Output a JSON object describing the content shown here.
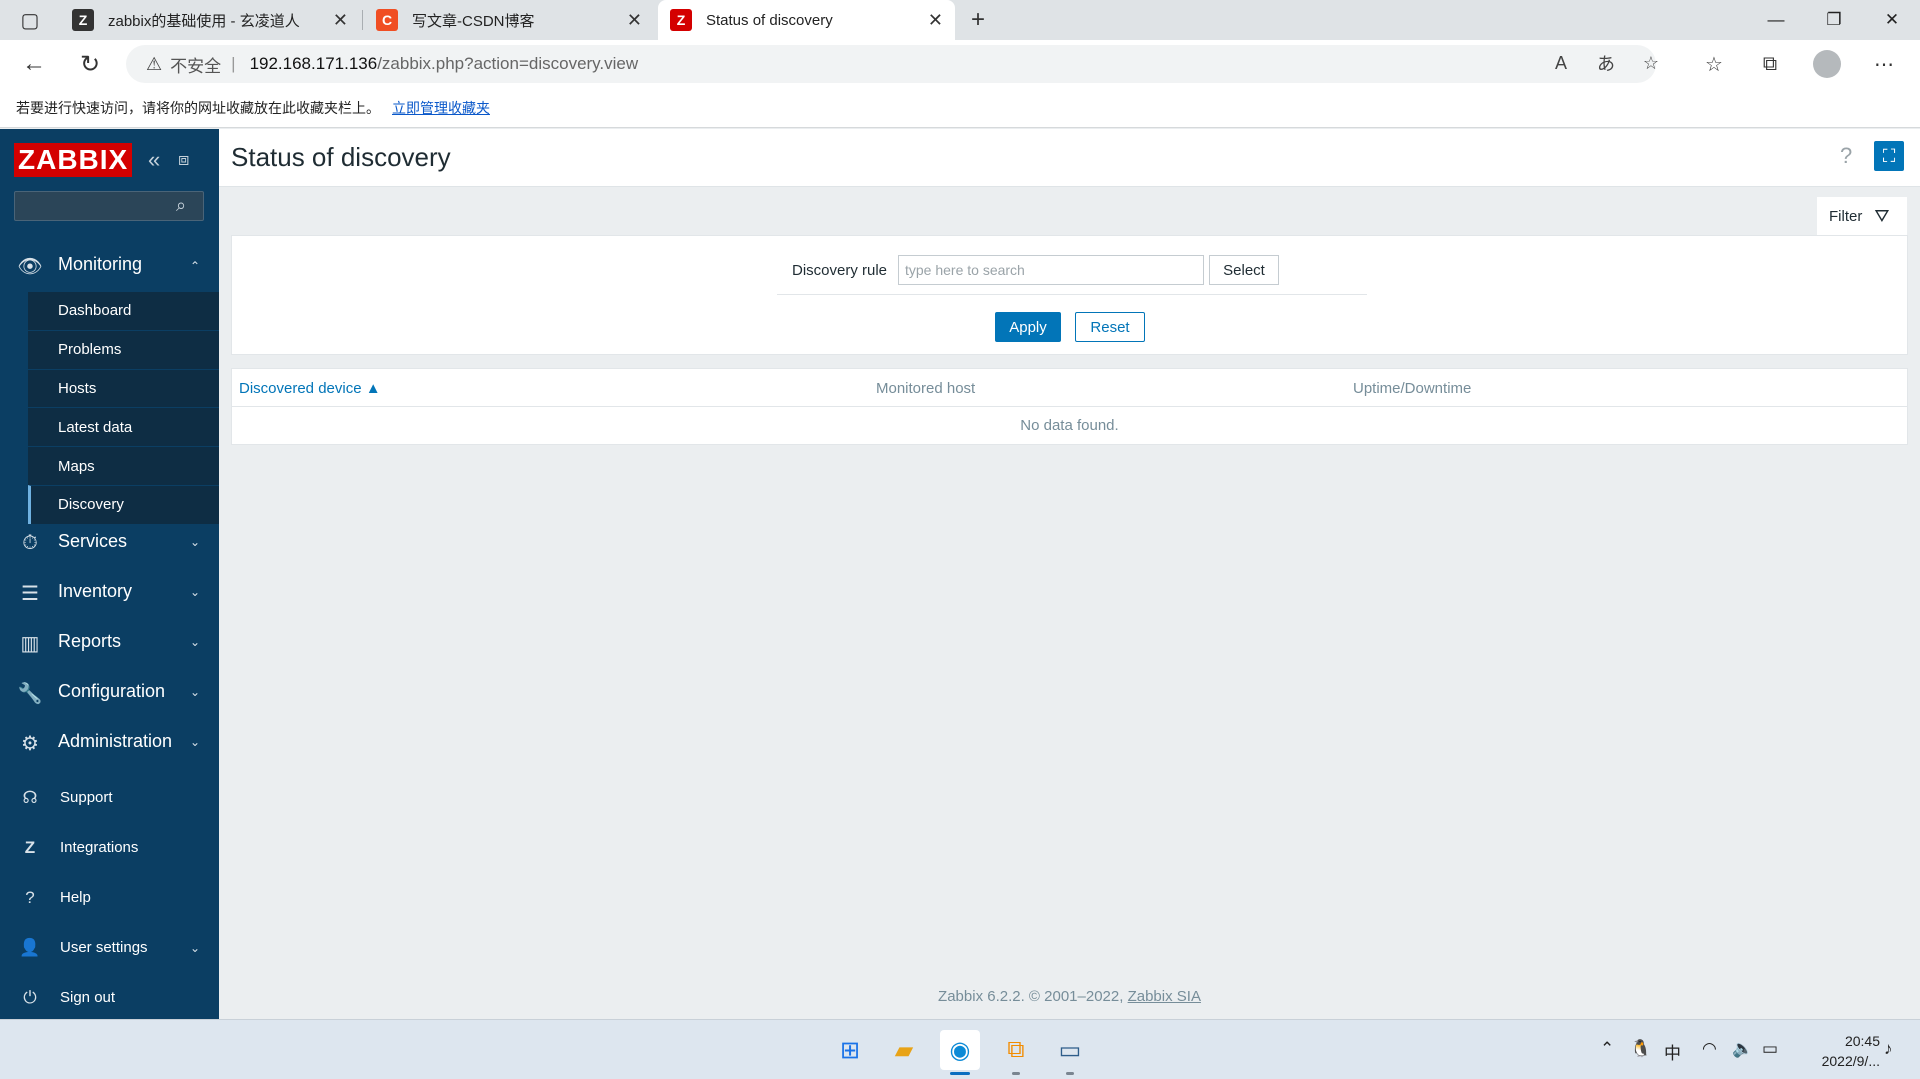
{
  "browser": {
    "tabs": [
      {
        "title": "zabbix的基础使用 - 玄凌道人",
        "favicon": "Z"
      },
      {
        "title": "写文章-CSDN博客",
        "favicon": "C"
      },
      {
        "title": "Status of discovery",
        "favicon": "Z"
      }
    ],
    "new_tab_icon": "plus-icon",
    "address": {
      "insecure_label": "不安全",
      "host": "192.168.171.136",
      "path": "/zabbix.php?action=discovery.view"
    },
    "favorites_bar": {
      "message": "若要进行快速访问，请将你的网址收藏放在此收藏夹栏上。",
      "link": "立即管理收藏夹"
    },
    "colors": {
      "edge_blue": "#0a58ca"
    }
  },
  "zabbix": {
    "logo": "ZABBIX",
    "search_placeholder": "",
    "menu": {
      "monitoring": {
        "label": "Monitoring",
        "items": [
          "Dashboard",
          "Problems",
          "Hosts",
          "Latest data",
          "Maps",
          "Discovery"
        ],
        "selected": "Discovery"
      },
      "services": "Services",
      "inventory": "Inventory",
      "reports": "Reports",
      "configuration": "Configuration",
      "administration": "Administration"
    },
    "footer_menu": {
      "support": "Support",
      "integrations": "Integrations",
      "help": "Help",
      "user_settings": "User settings",
      "sign_out": "Sign out"
    },
    "page_title": "Status of discovery",
    "help_icon": "?",
    "filter": {
      "tab_label": "Filter",
      "rule_label": "Discovery rule",
      "rule_placeholder": "type here to search",
      "select_label": "Select",
      "apply_label": "Apply",
      "reset_label": "Reset"
    },
    "table": {
      "columns": [
        "Discovered device ▲",
        "Monitored host",
        "Uptime/Downtime"
      ],
      "empty_message": "No data found."
    },
    "footer": {
      "text": "Zabbix 6.2.2. © 2001–2022,",
      "link": "Zabbix SIA"
    },
    "colors": {
      "sidebar": "#0b3e63",
      "primary": "#0275b8",
      "logo_red": "#d40000"
    }
  },
  "taskbar": {
    "ime": "中",
    "time": "20:45",
    "date": "2022/9/..."
  }
}
